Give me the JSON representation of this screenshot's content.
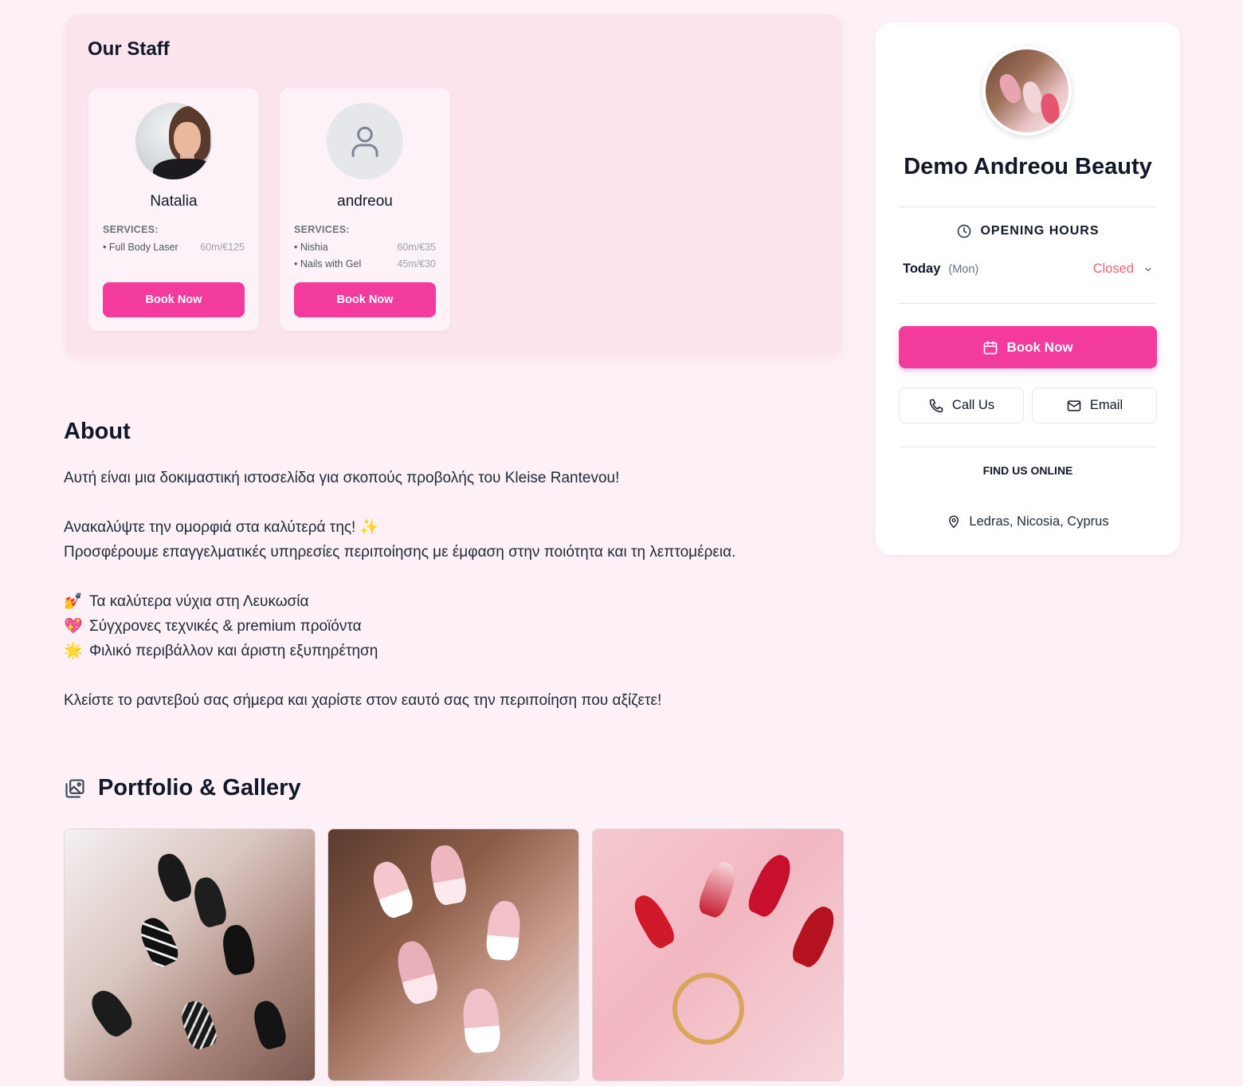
{
  "staff": {
    "title": "Our Staff",
    "services_label": "SERVICES:",
    "book_label": "Book Now",
    "members": [
      {
        "name": "Natalia",
        "avatar": "photo",
        "services": [
          {
            "name": "• Full Body Laser",
            "meta": "60m/€125"
          }
        ]
      },
      {
        "name": "andreou",
        "avatar": "user-icon",
        "services": [
          {
            "name": "• Nishia",
            "meta": "60m/€35"
          },
          {
            "name": "• Nails with Gel",
            "meta": "45m/€30"
          }
        ]
      }
    ]
  },
  "about": {
    "title": "About",
    "intro": "Αυτή είναι μια δοκιμαστική ιστοσελίδα για σκοπούς προβολής του Kleise Rantevou!",
    "line1": "Ανακαλύψτε την ομορφιά στα καλύτερά της! ✨",
    "line2": "Προσφέρουμε επαγγελματικές υπηρεσίες περιποίησης με έμφαση στην ποιότητα και τη λεπτομέρεια.",
    "bullets": [
      {
        "emoji": "💅",
        "text": "Τα καλύτερα νύχια στη Λευκωσία"
      },
      {
        "emoji": "💖",
        "text": "Σύγχρονες τεχνικές & premium προϊόντα"
      },
      {
        "emoji": "🌟",
        "text": "Φιλικό περιβάλλον και άριστη εξυπηρέτηση"
      }
    ],
    "closing": "Κλείστε το ραντεβού σας σήμερα και χαρίστε στον εαυτό σας την περιποίηση που αξίζετε!"
  },
  "portfolio": {
    "title": "Portfolio & Gallery",
    "icon": "gallery-icon",
    "images": [
      "black-white-nails",
      "pink-french-nails",
      "red-glitter-nails"
    ]
  },
  "sidebar": {
    "business_name": "Demo Andreou Beauty",
    "opening_hours_label": "OPENING HOURS",
    "today_label": "Today",
    "today_day": "(Mon)",
    "today_status": "Closed",
    "book_label": "Book Now",
    "call_label": "Call Us",
    "email_label": "Email",
    "find_online_label": "FIND US ONLINE",
    "location": "Ledras, Nicosia, Cyprus"
  },
  "colors": {
    "page_bg": "#fdf0f6",
    "staff_bg": "#fce4ef",
    "primary": "#f23b9d",
    "closed": "#f0626f"
  }
}
